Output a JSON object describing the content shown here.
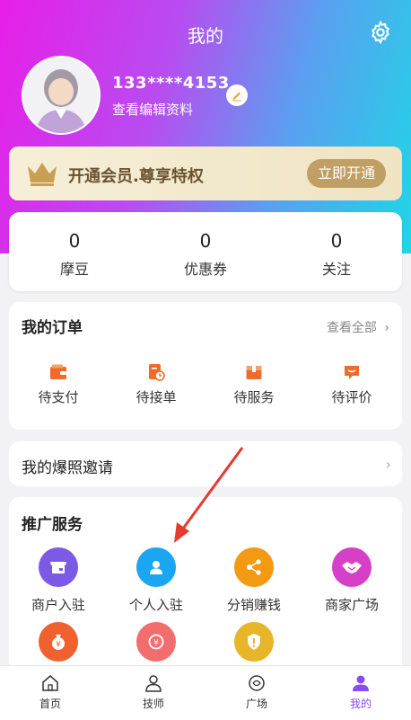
{
  "header": {
    "title": "我的"
  },
  "profile": {
    "phone": "133****4153",
    "edit_link": "查看编辑资料"
  },
  "vip": {
    "text": "开通会员.尊享特权",
    "button": "立即开通"
  },
  "stats": [
    {
      "value": "0",
      "label": "摩豆"
    },
    {
      "value": "0",
      "label": "优惠券"
    },
    {
      "value": "0",
      "label": "关注"
    }
  ],
  "orders": {
    "title": "我的订单",
    "view_all": "查看全部",
    "chevron": "›",
    "items": [
      {
        "label": "待支付",
        "icon": "wallet-icon"
      },
      {
        "label": "待接单",
        "icon": "clock-document-icon"
      },
      {
        "label": "待服务",
        "icon": "box-icon"
      },
      {
        "label": "待评价",
        "icon": "comment-icon"
      }
    ]
  },
  "invite": {
    "label": "我的爆照邀请",
    "chevron": "›"
  },
  "promo": {
    "title": "推广服务",
    "items": [
      {
        "label": "商户入驻",
        "icon": "store-icon",
        "color": "#7b5be6"
      },
      {
        "label": "个人入驻",
        "icon": "person-icon",
        "color": "#1aa6f0"
      },
      {
        "label": "分销赚钱",
        "icon": "share-icon",
        "color": "#f39a12"
      },
      {
        "label": "商家广场",
        "icon": "handshake-icon",
        "color": "#d640c8"
      },
      {
        "label": "",
        "icon": "money-bag-icon",
        "color": "#f0612f"
      },
      {
        "label": "",
        "icon": "refund-icon",
        "color": "#f26d6d"
      },
      {
        "label": "",
        "icon": "shield-alert-icon",
        "color": "#e6b528"
      }
    ]
  },
  "tabbar": {
    "items": [
      {
        "label": "首页",
        "icon": "home-icon"
      },
      {
        "label": "技师",
        "icon": "technician-icon"
      },
      {
        "label": "广场",
        "icon": "plaza-icon"
      },
      {
        "label": "我的",
        "icon": "profile-icon",
        "active": true
      }
    ],
    "active_color": "#8a4cf0"
  }
}
